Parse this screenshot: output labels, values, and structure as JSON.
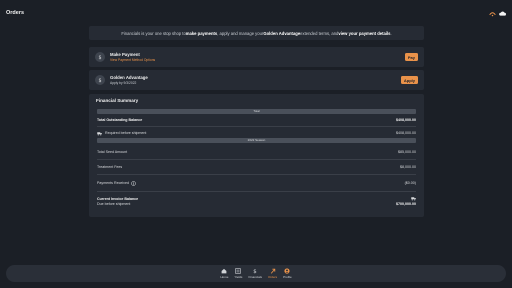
{
  "topbar": {
    "title": "Orders"
  },
  "info": {
    "prefix": "Financials is your one stop shop to ",
    "b1": "make payments",
    "mid1": ", apply and manage your ",
    "b2": "Golden Advantage",
    "mid2": " extended terms, and ",
    "b3": "view your payment details",
    "suffix": "."
  },
  "make_payment": {
    "title": "Make Payment",
    "subtitle": "View Payment Method Options",
    "button": "Pay"
  },
  "golden": {
    "title": "Golden Advantage",
    "subtitle": "Apply by 9/3/2022",
    "button": "Apply"
  },
  "summary": {
    "title": "Financial Summary",
    "total_header": "Total",
    "outstanding_label": "Total Outstanding Balance",
    "outstanding_value": "$408,000.00",
    "required_label": "Required before shipment",
    "required_value": "$408,000.00",
    "season_header": "2022 Season",
    "seed_label": "Total Seed Amount",
    "seed_value": "$85,000.00",
    "treatment_label": "Treatment Fees",
    "treatment_value": "$8,000.00",
    "payments_label": "Payments Received",
    "payments_value": "($0.00)",
    "invoice_label": "Current Invoice Balance",
    "invoice_sub": "Due before shipment",
    "invoice_value": "$700,000.00"
  },
  "nav": [
    {
      "label": "Home",
      "icon": "home-icon"
    },
    {
      "label": "Yields",
      "icon": "yields-icon"
    },
    {
      "label": "Financials",
      "icon": "dollar-icon"
    },
    {
      "label": "Orders",
      "icon": "orders-icon"
    },
    {
      "label": "Profile",
      "icon": "profile-icon"
    }
  ],
  "colors": {
    "accent": "#e9924a",
    "background": "#1b1f26",
    "card": "#262b34"
  }
}
